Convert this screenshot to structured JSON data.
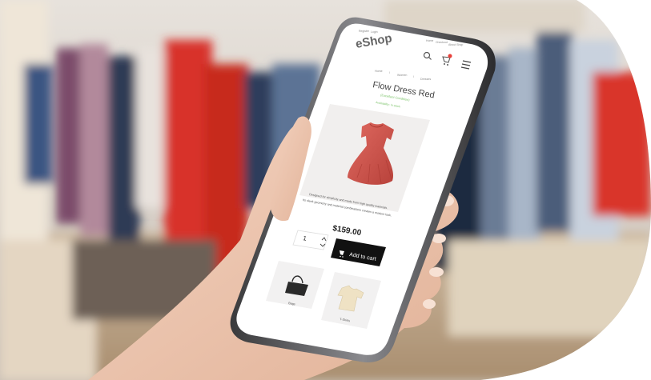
{
  "app": {
    "brand": "eShop",
    "top_links_left": [
      "Register",
      "Login"
    ],
    "top_links_right": [
      "Home",
      "Checkout",
      "About Shop"
    ],
    "cart_count": "0"
  },
  "breadcrumb": [
    "Home",
    "Women",
    "Dresses"
  ],
  "product": {
    "title": "Flow Dress Red",
    "subtitle": "(Excellent Condition)",
    "availability": "Availability: In stock",
    "description_line1": "Designed for simplicity and made from high quality materials.",
    "description_line2": "Its sleek geometry and material combinations creates a modern look.",
    "price": "$159.00",
    "quantity": "1",
    "add_to_cart_label": "Add to cart"
  },
  "related": [
    {
      "label": "Bags",
      "icon": "handbag-icon"
    },
    {
      "label": "T-Shirts",
      "icon": "tshirt-icon"
    }
  ],
  "colors": {
    "accent_green": "#7cc36a",
    "dress_red": "#d9574f",
    "button_black": "#111111",
    "badge_red": "#e8403a"
  }
}
